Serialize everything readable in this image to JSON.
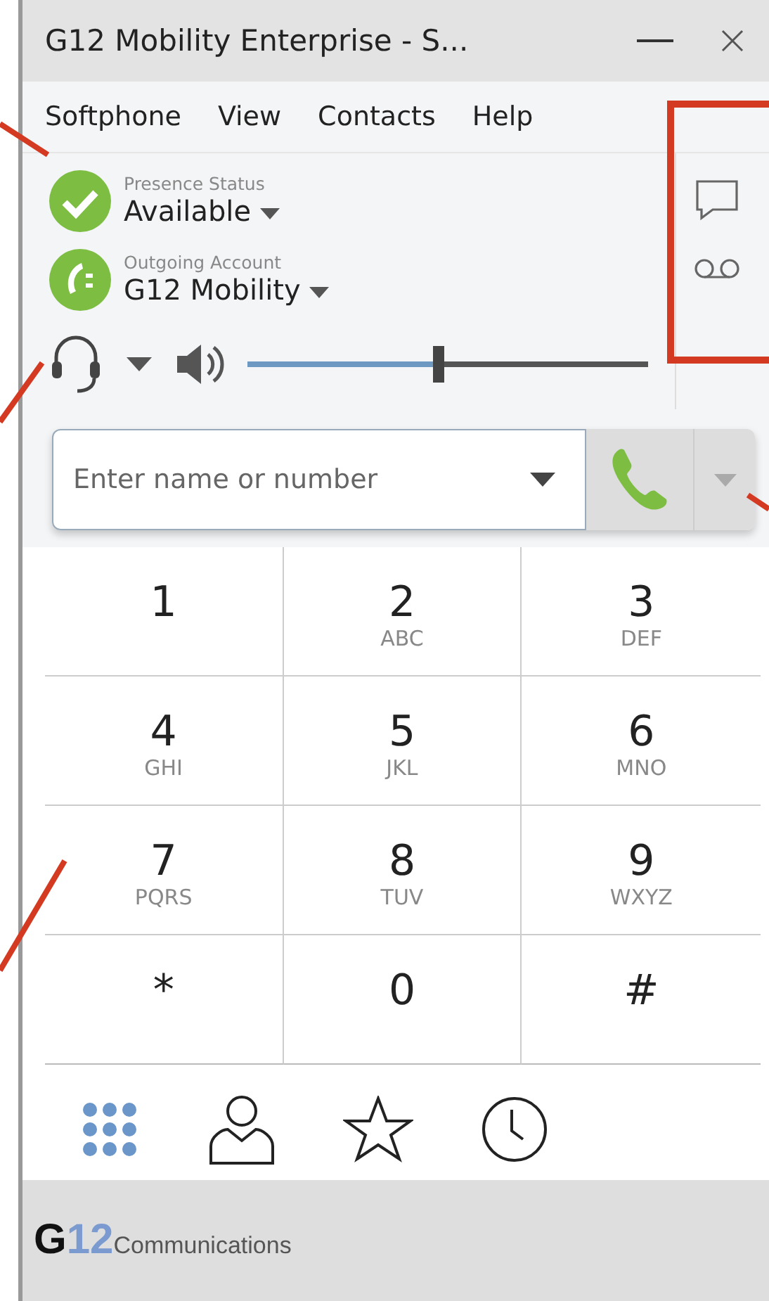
{
  "window": {
    "title": "G12 Mobility Enterprise - S..."
  },
  "menu": [
    "Softphone",
    "View",
    "Contacts",
    "Help"
  ],
  "presence": {
    "label": "Presence Status",
    "value": "Available"
  },
  "account": {
    "label": "Outgoing Account",
    "value": "G12 Mobility"
  },
  "volume": {
    "level": 0.48
  },
  "dial_field": {
    "placeholder": "Enter name or number"
  },
  "keypad": [
    {
      "digit": "1"
    },
    {
      "digit": "2",
      "letters": "ABC"
    },
    {
      "digit": "3",
      "letters": "DEF"
    },
    {
      "digit": "4",
      "letters": "GHI"
    },
    {
      "digit": "5",
      "letters": "JKL"
    },
    {
      "digit": "6",
      "letters": "MNO"
    },
    {
      "digit": "7",
      "letters": "PQRS"
    },
    {
      "digit": "8",
      "letters": "TUV"
    },
    {
      "digit": "9",
      "letters": "WXYZ"
    },
    {
      "digit": "*"
    },
    {
      "digit": "0"
    },
    {
      "digit": "#"
    }
  ],
  "nav": [
    {
      "kind": "dialpad",
      "selected": true
    },
    {
      "kind": "contacts",
      "selected": false
    },
    {
      "kind": "favorites",
      "selected": false
    },
    {
      "kind": "history",
      "selected": false
    }
  ],
  "logo": {
    "mark": "G",
    "number": "12",
    "text": "Communications"
  }
}
